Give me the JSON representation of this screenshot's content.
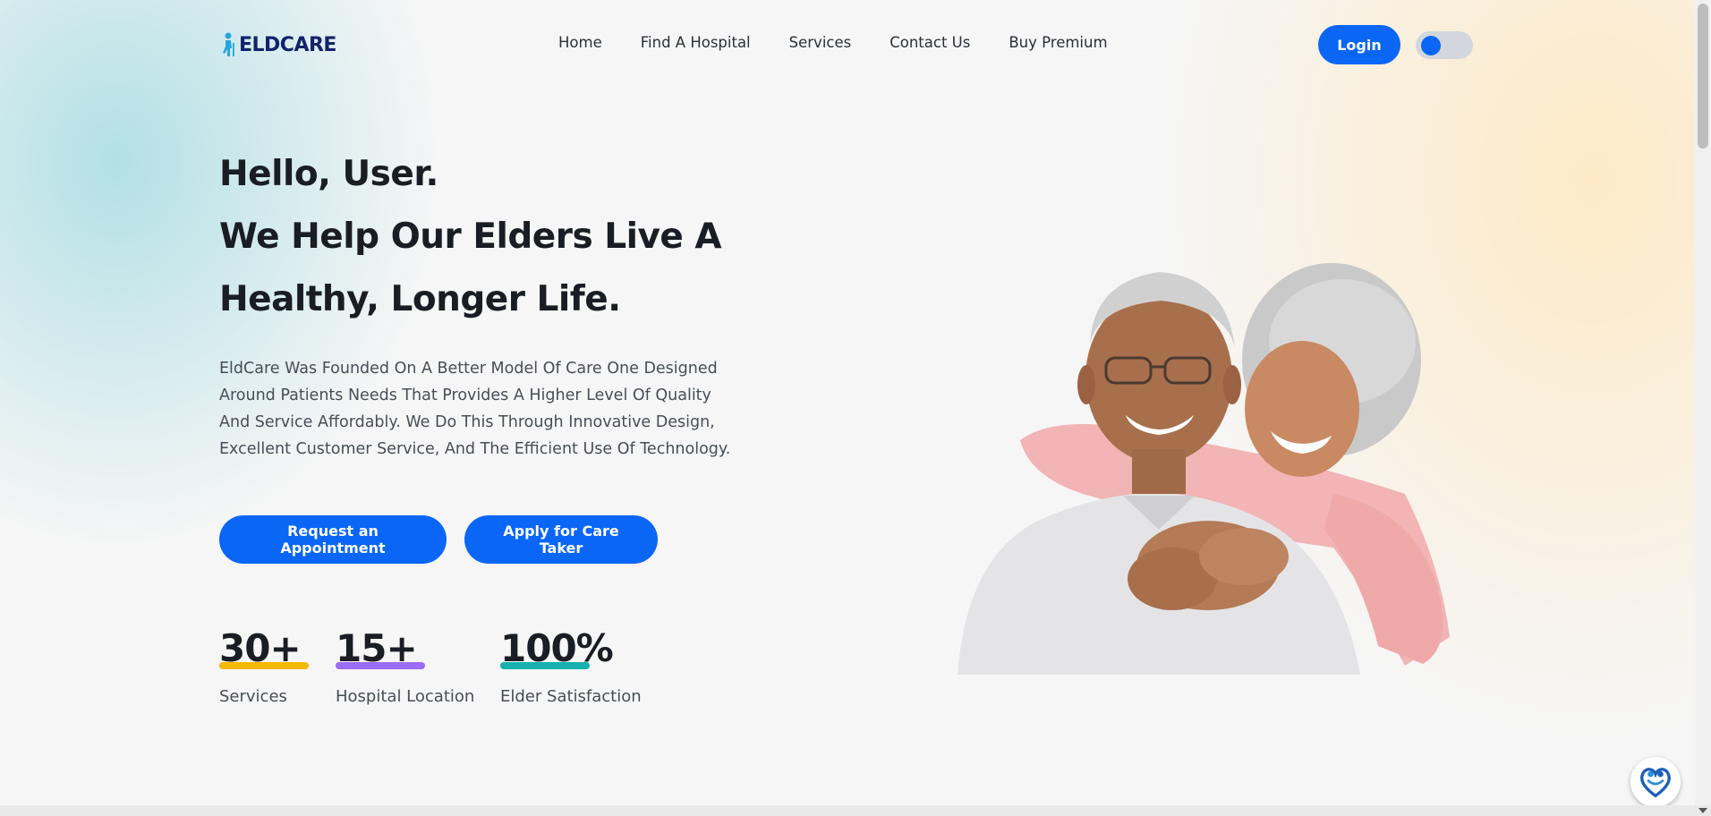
{
  "header": {
    "logo_text": "ELDCARE",
    "nav": [
      "Home",
      "Find A Hospital",
      "Services",
      "Contact Us",
      "Buy Premium"
    ],
    "login_label": "Login",
    "theme_toggle": "theme-toggle"
  },
  "hero": {
    "greeting": "Hello, User.",
    "headline_1": "We Help Our Elders Live A",
    "headline_2": "Healthy, Longer Life.",
    "description": "EldCare Was Founded On A Better Model Of Care One Designed Around Patients Needs That Provides A Higher Level Of Quality And Service Affordably. We Do This Through Innovative Design, Excellent Customer Service, And The Efficient Use Of Technology.",
    "cta_primary": "Request an Appointment",
    "cta_secondary": "Apply for Care Taker",
    "image": "elderly-couple-photo"
  },
  "stats": [
    {
      "value": "30+",
      "label": "Services",
      "color": "#f5b800"
    },
    {
      "value": "15+",
      "label": "Hospital Location",
      "color": "#9b6cf5"
    },
    {
      "value": "100%",
      "label": "Elder Satisfaction",
      "color": "#16b0b0"
    }
  ],
  "colors": {
    "accent": "#0a66f5",
    "logo": "#12236b"
  },
  "icons": {
    "logo": "elder-figure-icon",
    "chat": "heart-care-chat-icon"
  }
}
